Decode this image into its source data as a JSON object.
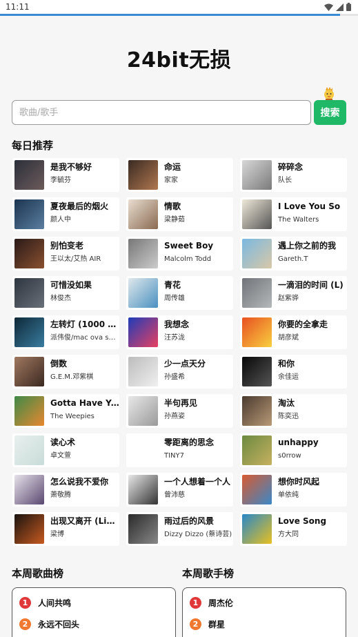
{
  "status": {
    "time": "11:11"
  },
  "loading": {
    "progress": 0.95
  },
  "app": {
    "title": "24bit无损"
  },
  "search": {
    "placeholder": "歌曲/歌手",
    "button": "搜索"
  },
  "daily": {
    "title": "每日推荐",
    "items": [
      {
        "song": "是我不够好",
        "artist": "李毓芬",
        "colors": [
          "#2a2f3a",
          "#6d5b5a"
        ]
      },
      {
        "song": "命运",
        "artist": "家家",
        "colors": [
          "#3a2a22",
          "#b07850"
        ]
      },
      {
        "song": "碎碎念",
        "artist": "队长",
        "colors": [
          "#d8d8d8",
          "#7a7a7a"
        ]
      },
      {
        "song": "夏夜最后的烟火",
        "artist": "颜人中",
        "colors": [
          "#1b3550",
          "#5b7ea0"
        ]
      },
      {
        "song": "情歌",
        "artist": "梁静茹",
        "colors": [
          "#e8ddd0",
          "#8a6a50"
        ]
      },
      {
        "song": "I Love You So",
        "artist": "The Walters",
        "colors": [
          "#efe8d8",
          "#555"
        ]
      },
      {
        "song": "别怕变老",
        "artist": "王以太/艾热 AIR",
        "colors": [
          "#2a1a18",
          "#8a5030"
        ]
      },
      {
        "song": "Sweet Boy",
        "artist": "Malcolm Todd",
        "colors": [
          "#777",
          "#ccc"
        ]
      },
      {
        "song": "遇上你之前的我",
        "artist": "Gareth.T",
        "colors": [
          "#7ab8e0",
          "#d8c8a8"
        ]
      },
      {
        "song": "可惜没如果",
        "artist": "林俊杰",
        "colors": [
          "#2d3540",
          "#6a7078"
        ]
      },
      {
        "song": "青花",
        "artist": "周传雄",
        "colors": [
          "#dfe8ec",
          "#4a90c0"
        ]
      },
      {
        "song": "一滴泪的时间 (L)",
        "artist": "赵紫骅",
        "colors": [
          "#707478",
          "#b5b8ba"
        ]
      },
      {
        "song": "左转灯 (1000 Ti...",
        "artist": "派伟俊/mac ova se...",
        "colors": [
          "#0e2838",
          "#3a7da0"
        ]
      },
      {
        "song": "我想念",
        "artist": "汪苏泷",
        "colors": [
          "#1e3cb8",
          "#e84060"
        ]
      },
      {
        "song": "你要的全拿走",
        "artist": "胡彦斌",
        "colors": [
          "#e85020",
          "#f8d040"
        ]
      },
      {
        "song": "倒数",
        "artist": "G.E.M.邓紫棋",
        "colors": [
          "#a07860",
          "#3a2820"
        ]
      },
      {
        "song": "少一点天分",
        "artist": "孙盛希",
        "colors": [
          "#bcbcbc",
          "#f0f0f0"
        ]
      },
      {
        "song": "和你",
        "artist": "余佳运",
        "colors": [
          "#080808",
          "#555"
        ]
      },
      {
        "song": "Gotta Have You",
        "artist": "The Weepies",
        "colors": [
          "#3e8a48",
          "#e88830"
        ]
      },
      {
        "song": "半句再见",
        "artist": "孙燕姿",
        "colors": [
          "#e8e8e8",
          "#9a9a9a"
        ]
      },
      {
        "song": "淘汰",
        "artist": "陈奕迅",
        "colors": [
          "#4a3a2e",
          "#b89a78"
        ]
      },
      {
        "song": "读心术",
        "artist": "卓文萱",
        "colors": [
          "#e8f0ee",
          "#c8dcd8"
        ]
      },
      {
        "song": "零距离的思念",
        "artist": "TINY7",
        "colors": [
          "#ffffff",
          "#ffffff"
        ]
      },
      {
        "song": "unhappy",
        "artist": "s0rrow",
        "colors": [
          "#6a8a40",
          "#c8b060"
        ]
      },
      {
        "song": "怎么说我不爱你",
        "artist": "萧敬腾",
        "colors": [
          "#e6e2ea",
          "#5a4870"
        ]
      },
      {
        "song": "一个人想着一个人",
        "artist": "曾沛慈",
        "colors": [
          "#e8e8e8",
          "#333"
        ]
      },
      {
        "song": "想你时风起",
        "artist": "单依纯",
        "colors": [
          "#d85a30",
          "#3a88c8"
        ]
      },
      {
        "song": "出现又离开 (Live)",
        "artist": "梁博",
        "colors": [
          "#1a1410",
          "#c85a20"
        ]
      },
      {
        "song": "雨过后的风景",
        "artist": "Dizzy Dizzo (蔡诗芸)",
        "colors": [
          "#2a2a2a",
          "#888"
        ]
      },
      {
        "song": "Love Song",
        "artist": "方大同",
        "colors": [
          "#2888c8",
          "#e8c020"
        ]
      }
    ]
  },
  "weekly_songs": {
    "title": "本周歌曲榜",
    "items": [
      {
        "rank": "1",
        "label": "人间共鸣",
        "color": "#e03838"
      },
      {
        "rank": "2",
        "label": "永远不回头",
        "color": "#f07830"
      }
    ]
  },
  "weekly_singers": {
    "title": "本周歌手榜",
    "items": [
      {
        "rank": "1",
        "label": "周杰伦",
        "color": "#e03838"
      },
      {
        "rank": "2",
        "label": "群星",
        "color": "#f07830"
      }
    ]
  }
}
